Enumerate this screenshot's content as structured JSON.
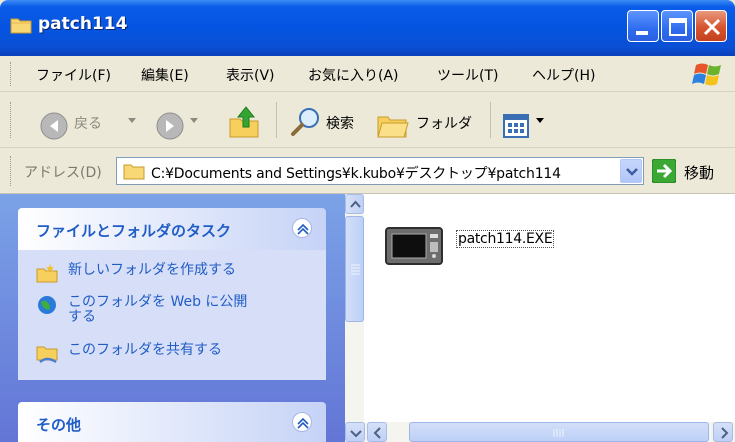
{
  "window": {
    "title": "patch114",
    "title_color": "#0554e1",
    "close_color": "#d7542e"
  },
  "menu": {
    "items": [
      "ファイル(F)",
      "編集(E)",
      "表示(V)",
      "お気に入り(A)",
      "ツール(T)",
      "ヘルプ(H)"
    ]
  },
  "toolbar": {
    "back_label": "戻る",
    "search_label": "検索",
    "folders_label": "フォルダ"
  },
  "address": {
    "label": "アドレス(D)",
    "path": "C:¥Documents and Settings¥k.kubo¥デスクトップ¥patch114",
    "go_label": "移動"
  },
  "task_pane": {
    "file_tasks_title": "ファイルとフォルダのタスク",
    "tasks": [
      {
        "label_lines": [
          "新しいフォルダを作成する"
        ],
        "icon": "new-folder-icon"
      },
      {
        "label_lines": [
          "このフォルダを Web に公開",
          "する"
        ],
        "icon": "publish-web-icon"
      },
      {
        "label_lines": [
          "このフォルダを共有する"
        ],
        "icon": "share-folder-icon"
      }
    ],
    "other_title": "その他"
  },
  "files": [
    {
      "name": "patch114.EXE",
      "icon": "executable-icon"
    }
  ]
}
